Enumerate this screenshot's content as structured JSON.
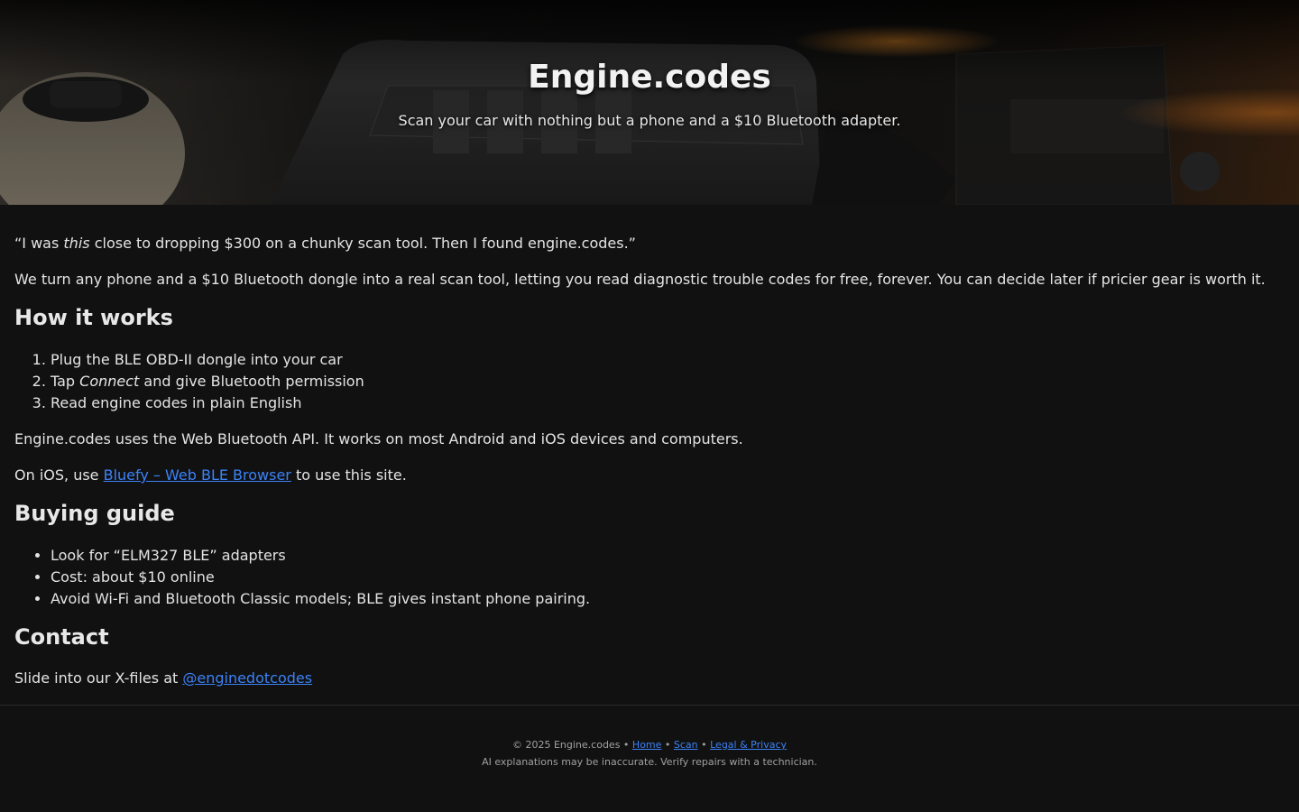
{
  "hero": {
    "title": "Engine.codes",
    "tagline": "Scan your car with nothing but a phone and a $10 Bluetooth adapter."
  },
  "intro": {
    "quote_open": "“I was ",
    "quote_em": "this",
    "quote_close": " close to dropping $300 on a chunky scan tool. Then I found engine.codes.”",
    "description": "We turn any phone and a $10 Bluetooth dongle into a real scan tool, letting you read diagnostic trouble codes for free, forever. You can decide later if pricier gear is worth it."
  },
  "how_it_works": {
    "heading": "How it works",
    "step1": "Plug the BLE OBD-II dongle into your car",
    "step2_pre": "Tap ",
    "step2_em": "Connect",
    "step2_post": " and give Bluetooth permission",
    "step3": "Read engine codes in plain English",
    "api_note": "Engine.codes uses the Web Bluetooth API. It works on most Android and iOS devices and computers.",
    "ios_pre": "On iOS, use ",
    "ios_link": "Bluefy – Web BLE Browser",
    "ios_post": " to use this site."
  },
  "buying_guide": {
    "heading": "Buying guide",
    "items": [
      "Look for “ELM327 BLE” adapters",
      "Cost: about $10 online",
      "Avoid Wi-Fi and Bluetooth Classic models; BLE gives instant phone pairing."
    ]
  },
  "contact": {
    "heading": "Contact",
    "text": "Slide into our X-files at ",
    "handle": "@enginedotcodes"
  },
  "footer": {
    "copyright": "© 2025 Engine.codes",
    "sep": " • ",
    "links": [
      "Home",
      "Scan",
      "Legal & Privacy"
    ],
    "disclaimer": "AI explanations may be inaccurate. Verify repairs with a technician."
  },
  "colors": {
    "background": "#111112",
    "link": "#3b82f6",
    "text": "#e4e4e4"
  }
}
